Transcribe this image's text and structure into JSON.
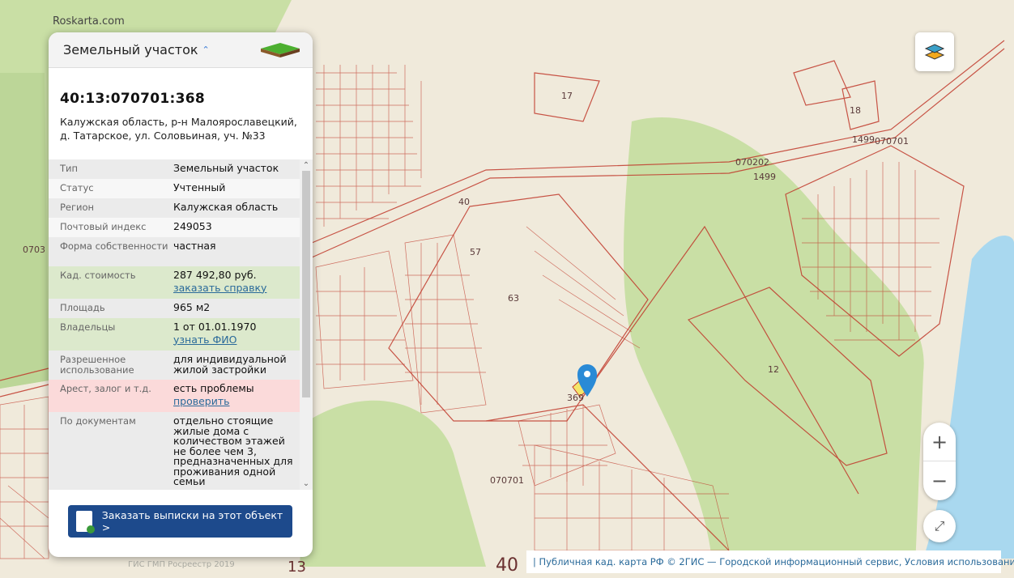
{
  "site": "Roskarta.com",
  "panel": {
    "title": "Земельный участок",
    "cad_number": "40:13:070701:368",
    "address": "Калужская область, р-н Малоярославецкий, д. Татарское, ул. Соловьиная, уч. №33",
    "rows": [
      {
        "k": "Тип",
        "v": "Земельный участок"
      },
      {
        "k": "Статус",
        "v": "Учтенный"
      },
      {
        "k": "Регион",
        "v": "Калужская область"
      },
      {
        "k": "Почтовый индекс",
        "v": "249053"
      },
      {
        "k": "Форма собственности",
        "v": "частная"
      },
      {
        "k": "Кад. стоимость",
        "v": "287 492,80 руб.",
        "link": "заказать справку"
      },
      {
        "k": "Площадь",
        "v": "965 м2"
      },
      {
        "k": "Владельцы",
        "v": "1 от 01.01.1970",
        "link": "узнать ФИО"
      },
      {
        "k": "Разрешенное использование",
        "v": "для индивидуальной жилой застройки"
      },
      {
        "k": "Арест, залог и т.д.",
        "v": "есть проблемы",
        "link": "проверить"
      },
      {
        "k": "По документам",
        "v": "отдельно стоящие жилые дома с количеством этажей не более чем 3, предназначенных для проживания одной семьи"
      }
    ],
    "order_button": "Заказать выписки на этот объект >",
    "footer": "ГИС ГМП Росреестр 2019"
  },
  "map": {
    "labels": [
      "070202",
      "070701",
      "070701",
      "1499",
      "1499",
      "63",
      "57",
      "12",
      "369",
      "17",
      "18",
      "40",
      "13",
      "0703"
    ],
    "attribution": "| Публичная кад. карта РФ © 2ГИС — Городской информационный сервис, Условия использования"
  },
  "controls": {
    "zoom_in": "+",
    "zoom_out": "−"
  }
}
